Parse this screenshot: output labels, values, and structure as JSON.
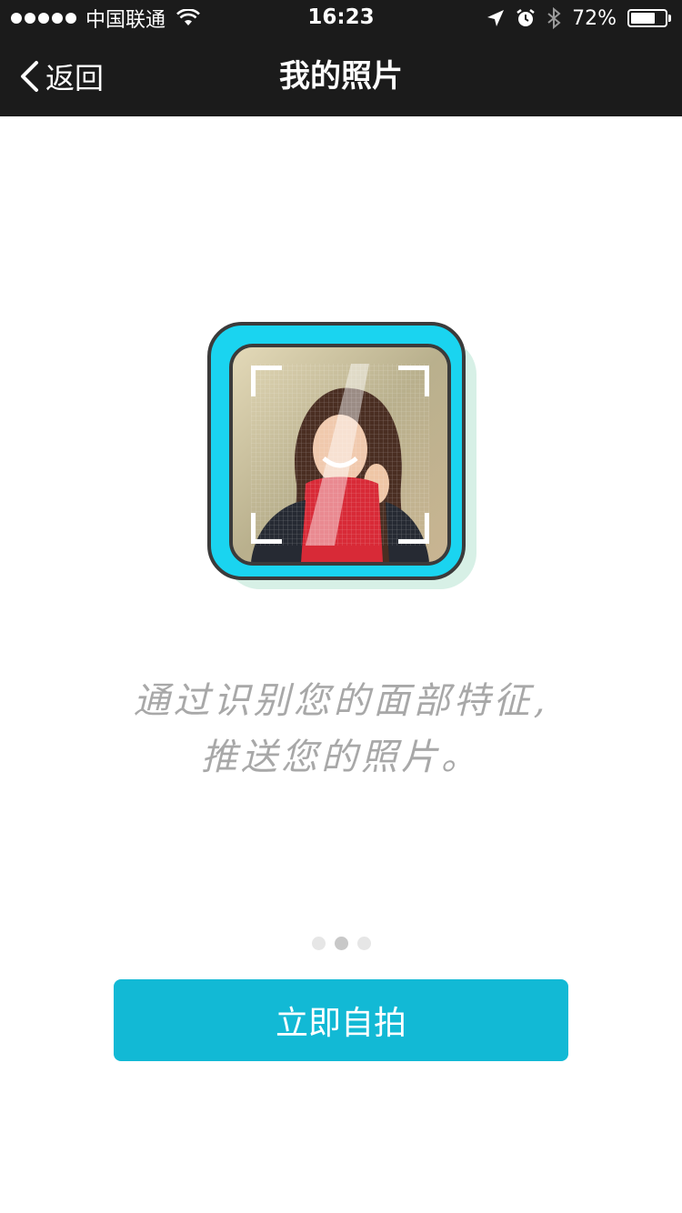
{
  "status_bar": {
    "carrier": "中国联通",
    "time": "16:23",
    "battery_percent": "72%",
    "battery_level": 0.72,
    "icons": [
      "signal-dots",
      "wifi-icon",
      "location-icon",
      "alarm-icon",
      "bluetooth-icon",
      "battery-icon"
    ]
  },
  "nav": {
    "back_label": "返回",
    "title": "我的照片"
  },
  "tagline": {
    "line1": "通过识别您的面部特征,",
    "line2": "推送您的照片。"
  },
  "pager": {
    "count": 3,
    "active_index": 1
  },
  "action": {
    "button_label": "立即自拍"
  },
  "colors": {
    "bar_bg": "#1b1b1b",
    "accent": "#12b9d5",
    "frame": "#1ad4f0",
    "tagline": "#a8a8a8"
  }
}
